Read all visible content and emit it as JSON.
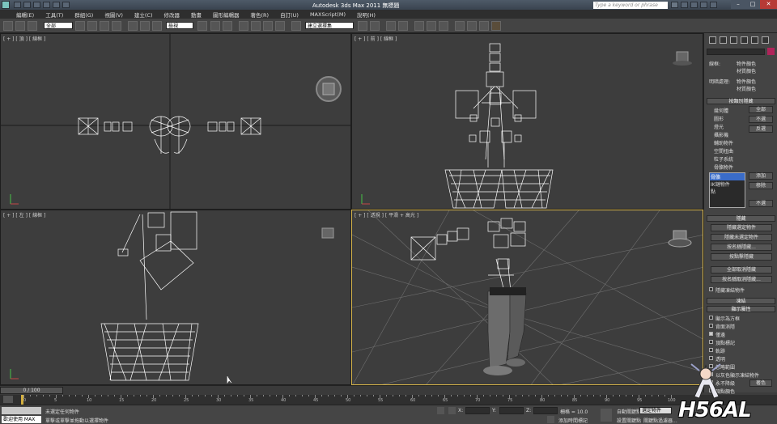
{
  "window": {
    "title": "Autodesk 3ds Max  2011     無標題",
    "search_placeholder": "Type a keyword or phrase"
  },
  "menu": [
    "編輯(E)",
    "工具(T)",
    "群組(G)",
    "視圖(V)",
    "建立(C)",
    "修改器",
    "動畫",
    "圖形編輯器",
    "著色(R)",
    "自訂(U)",
    "MAXScript(M)",
    "說明(H)"
  ],
  "toolbar": {
    "selection_filter": "全部",
    "ref_coord": "檢視",
    "named_sel": "建立選擇集"
  },
  "viewports": {
    "top": "[ + ] [ 頂 ] [ 線框 ]",
    "front": "[ + ] [ 前 ] [ 線框 ]",
    "left": "[ + ] [ 左 ] [ 線框 ]",
    "persp": "[ + ] [ 透視 ] [ 平滑 + 高光 ]"
  },
  "command_panel": {
    "display_color": "顯示:",
    "wireframe_label": "線框:",
    "shaded_label": "明暗處理:",
    "opt_object_color": "物件顏色",
    "opt_material_color": "材質顏色",
    "hide_by_category": "按類別隱藏",
    "categories": [
      "幾何體",
      "圖形",
      "燈光",
      "攝影機",
      "輔助物件",
      "空間扭曲",
      "粒子系統",
      "骨骼物件"
    ],
    "cat_buttons": [
      "全部",
      "不選",
      "反選"
    ],
    "list_items": [
      "骨骼",
      "IK鏈物件",
      "點"
    ],
    "list_buttons": [
      "添加",
      "移除",
      "不選"
    ],
    "hide_head": "隱藏",
    "hide_buttons": [
      "隱藏選定物件",
      "隱藏未選定物件",
      "按名稱隱藏...",
      "按點擊隱藏",
      "全部取消隱藏",
      "按名稱取消隱藏...",
      "隱藏凍結物件"
    ],
    "freeze_head": "凍結",
    "display_props_head": "顯示屬性",
    "display_props": [
      "顯示為方框",
      "背面消隱",
      "僅邊",
      "頂點標記",
      "軌跡",
      "透明",
      "忽略範圍",
      "以灰色顯示凍結物件",
      "永不降級",
      "頂點顏色"
    ],
    "color_btn": "著色"
  },
  "timeline": {
    "frame": "0 / 100",
    "ticks": [
      "0",
      "5",
      "10",
      "15",
      "20",
      "25",
      "30",
      "35",
      "40",
      "45",
      "50",
      "55",
      "60",
      "65",
      "70",
      "75",
      "80",
      "85",
      "90",
      "95",
      "100"
    ]
  },
  "status": {
    "welcome": "歡迎使用 MAX",
    "line1": "未選定任何物件",
    "line2": "單擊或單擊並拖動以選擇物件",
    "x": "X:",
    "y": "Y:",
    "z": "Z:",
    "grid": "柵格 = 10.0",
    "add_time_tag": "添加時間標記",
    "auto_key": "自動關鍵點",
    "set_key": "設置關鍵點",
    "selected": "選定物件",
    "key_filter": "關鍵點過濾器..."
  },
  "watermark": "H56AL"
}
